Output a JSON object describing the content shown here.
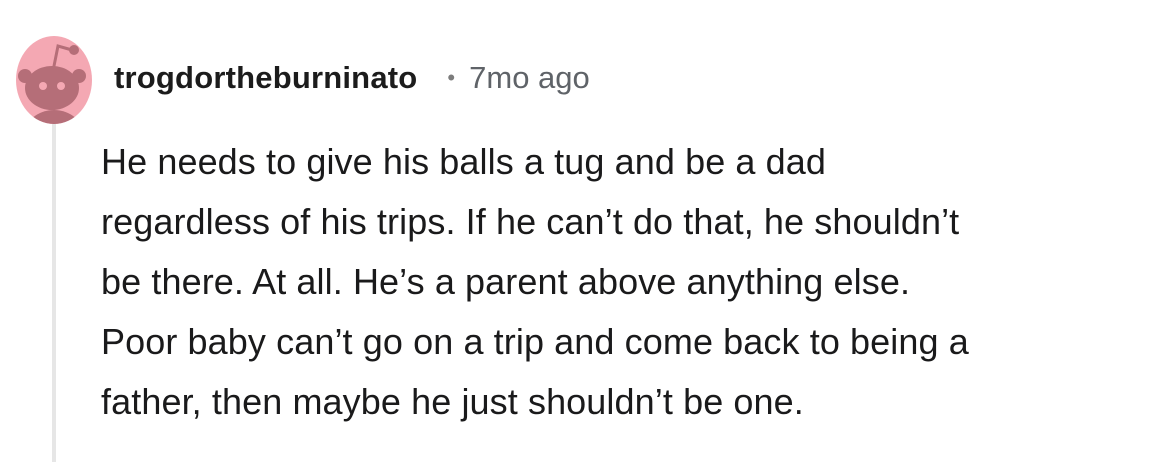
{
  "comment": {
    "author": "trogdortheburninato",
    "separator": "•",
    "timestamp": "7mo ago",
    "body_lines": [
      "He needs to give his balls a tug and be a dad",
      "regardless of his trips. If he can’t do that, he shouldn’t",
      "be there. At all. He’s a parent above anything else.",
      "Poor baby can’t go on a trip and come back to being a",
      "father, then maybe he just shouldn’t be one."
    ]
  },
  "avatar": {
    "icon": "snoo-avatar-icon",
    "background_color": "#f4a8b3",
    "snoo_color": "#b56e78"
  },
  "colors": {
    "thread_line": "#e6e6e6",
    "text": "#1a1a1b",
    "meta": "#5f6368"
  }
}
